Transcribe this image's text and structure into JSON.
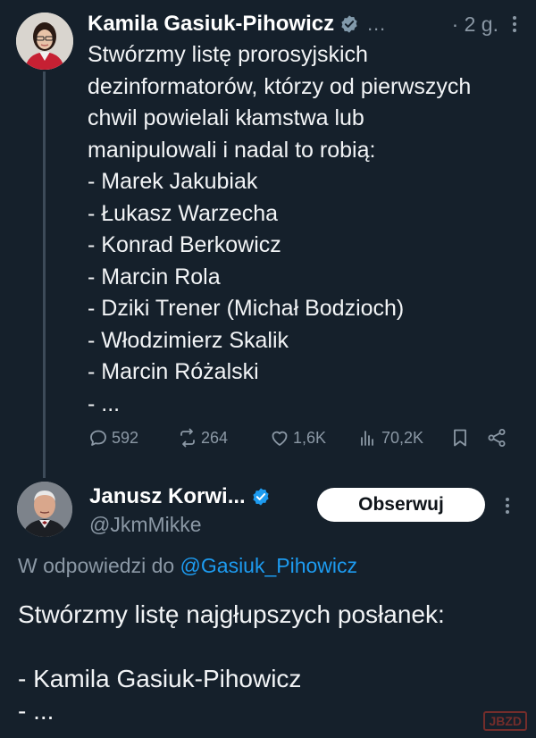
{
  "tweet1": {
    "author_name": "Kamila Gasiuk-Pihowicz",
    "ellipsis": "…",
    "time": "· 2 g.",
    "text": "Stwórzmy listę prorosyjskich\ndezinformatorów, którzy od pierwszych\nchwil powielali kłamstwa lub\nmanipulowali i nadal to robią:\n- Marek Jakubiak\n- Łukasz Warzecha\n- Konrad Berkowicz\n- Marcin Rola\n- Dziki Trener (Michał Bodzioch)\n- Włodzimierz Skalik\n- Marcin Różalski\n- ...",
    "replies": "592",
    "retweets": "264",
    "likes": "1,6K",
    "views": "70,2K"
  },
  "tweet2": {
    "author_name": "Janusz Korwi...",
    "handle": "@JkmMikke",
    "follow_label": "Obserwuj",
    "reply_prefix": "W odpowiedzi do",
    "reply_mention": "@Gasiuk_Pihowicz",
    "text": "Stwórzmy listę najgłupszych posłanek:\n\n- Kamila Gasiuk-Pihowicz\n- ..."
  },
  "watermark": "JBZD",
  "colors": {
    "background": "#15202b",
    "accent": "#1d9bf0",
    "muted": "#8b98a5"
  },
  "icons": [
    "verified-icon",
    "more-icon",
    "reply-icon",
    "retweet-icon",
    "like-icon",
    "views-icon",
    "bookmark-icon",
    "share-icon"
  ]
}
